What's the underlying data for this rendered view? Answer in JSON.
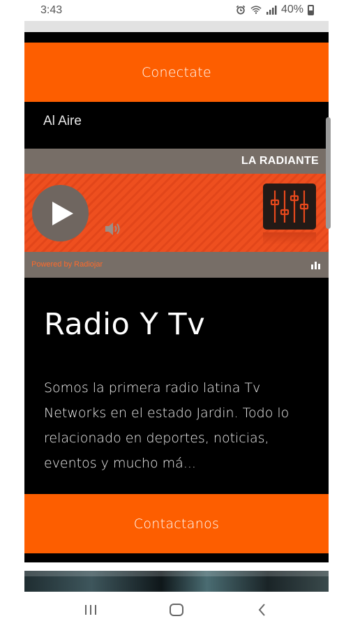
{
  "status_bar": {
    "time": "3:43",
    "battery": "40%",
    "icons": [
      "alarm-icon",
      "wifi-icon",
      "signal-icon",
      "battery-icon"
    ]
  },
  "buttons": {
    "connect_label": "Conectate",
    "contact_label": "Contactanos"
  },
  "on_air_label": "Al Aire",
  "player": {
    "station_name": "LA RADIANTE",
    "powered_by": "Powered by Radiojar",
    "icons": [
      "play-icon",
      "volume-icon",
      "equalizer-icon",
      "stats-icon"
    ]
  },
  "content": {
    "headline": "Radio Y Tv",
    "description": "Somos la primera radio latina Tv Networks en el estado Jardin. Todo lo relacionado en deportes, noticias, eventos y mucho má..."
  },
  "nav_bar": {
    "icons": [
      "recent-apps-icon",
      "home-icon",
      "back-icon"
    ]
  },
  "colors": {
    "accent_orange": "#fd5e00",
    "player_orange": "#ee4f1f",
    "player_gray": "#776e67",
    "card_background": "#000000"
  }
}
